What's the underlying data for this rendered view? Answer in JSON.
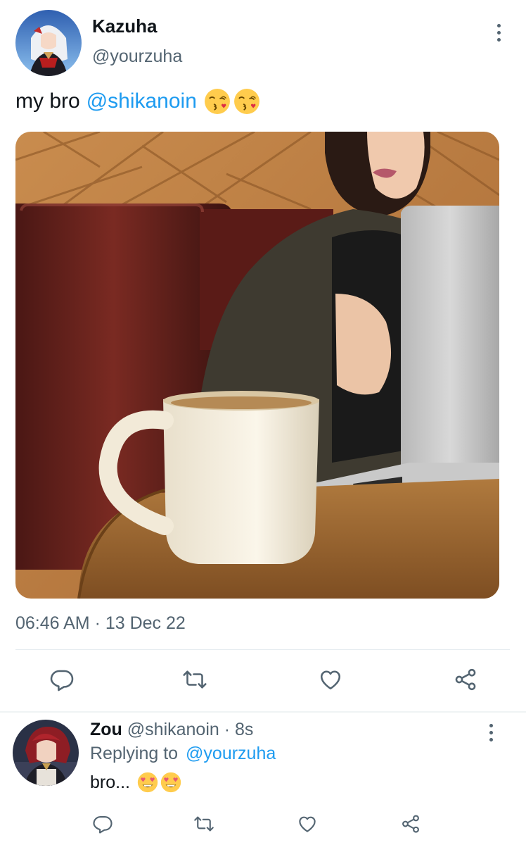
{
  "tweet": {
    "author_name": "Kazuha",
    "author_handle": "@yourzuha",
    "text_prefix": "my bro",
    "mention": "@shikanoin",
    "emojis": [
      "kissing-heart-emoji",
      "kissing-heart-emoji"
    ],
    "timestamp": "06:46 AM · 13 Dec 22",
    "actions": [
      "reply-icon",
      "retweet-icon",
      "like-icon",
      "share-icon"
    ]
  },
  "reply": {
    "author_name": "Zou",
    "author_handle": "@shikanoin",
    "age": "· 8s",
    "replying_label": "Replying to",
    "replying_to": "@yourzuha",
    "text": "bro...",
    "emojis": [
      "heart-eyes-emoji",
      "heart-eyes-emoji"
    ],
    "actions": [
      "reply-icon",
      "retweet-icon",
      "like-icon",
      "share-icon"
    ]
  },
  "colors": {
    "accent": "#1d9bf0",
    "text_primary": "#0f1419",
    "text_secondary": "#536471",
    "icon": "#536471"
  }
}
